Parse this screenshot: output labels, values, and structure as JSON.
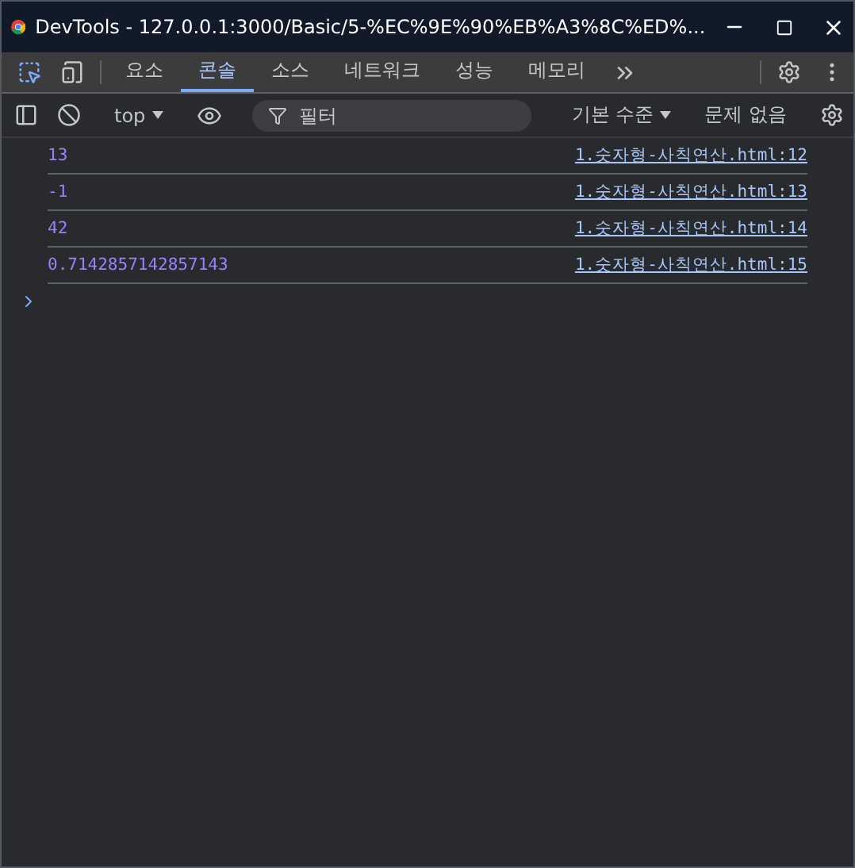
{
  "window": {
    "title": "DevTools - 127.0.0.1:3000/Basic/5-%EC%9E%90%EB%A3%8C%ED%..."
  },
  "tabs": [
    {
      "label": "요소",
      "selected": false
    },
    {
      "label": "콘솔",
      "selected": true
    },
    {
      "label": "소스",
      "selected": false
    },
    {
      "label": "네트워크",
      "selected": false
    },
    {
      "label": "성능",
      "selected": false
    },
    {
      "label": "메모리",
      "selected": false
    }
  ],
  "toolbar": {
    "context": "top",
    "filter": {
      "placeholder": "필터"
    },
    "levels": "기본 수준",
    "issues": "문제 없음"
  },
  "messages": [
    {
      "value": "13",
      "source": "1.숫자형-사칙연산.html:12"
    },
    {
      "value": "-1",
      "source": "1.숫자형-사칙연산.html:13"
    },
    {
      "value": "42",
      "source": "1.숫자형-사칙연산.html:14"
    },
    {
      "value": "0.7142857142857143",
      "source": "1.숫자형-사칙연산.html:15"
    }
  ]
}
